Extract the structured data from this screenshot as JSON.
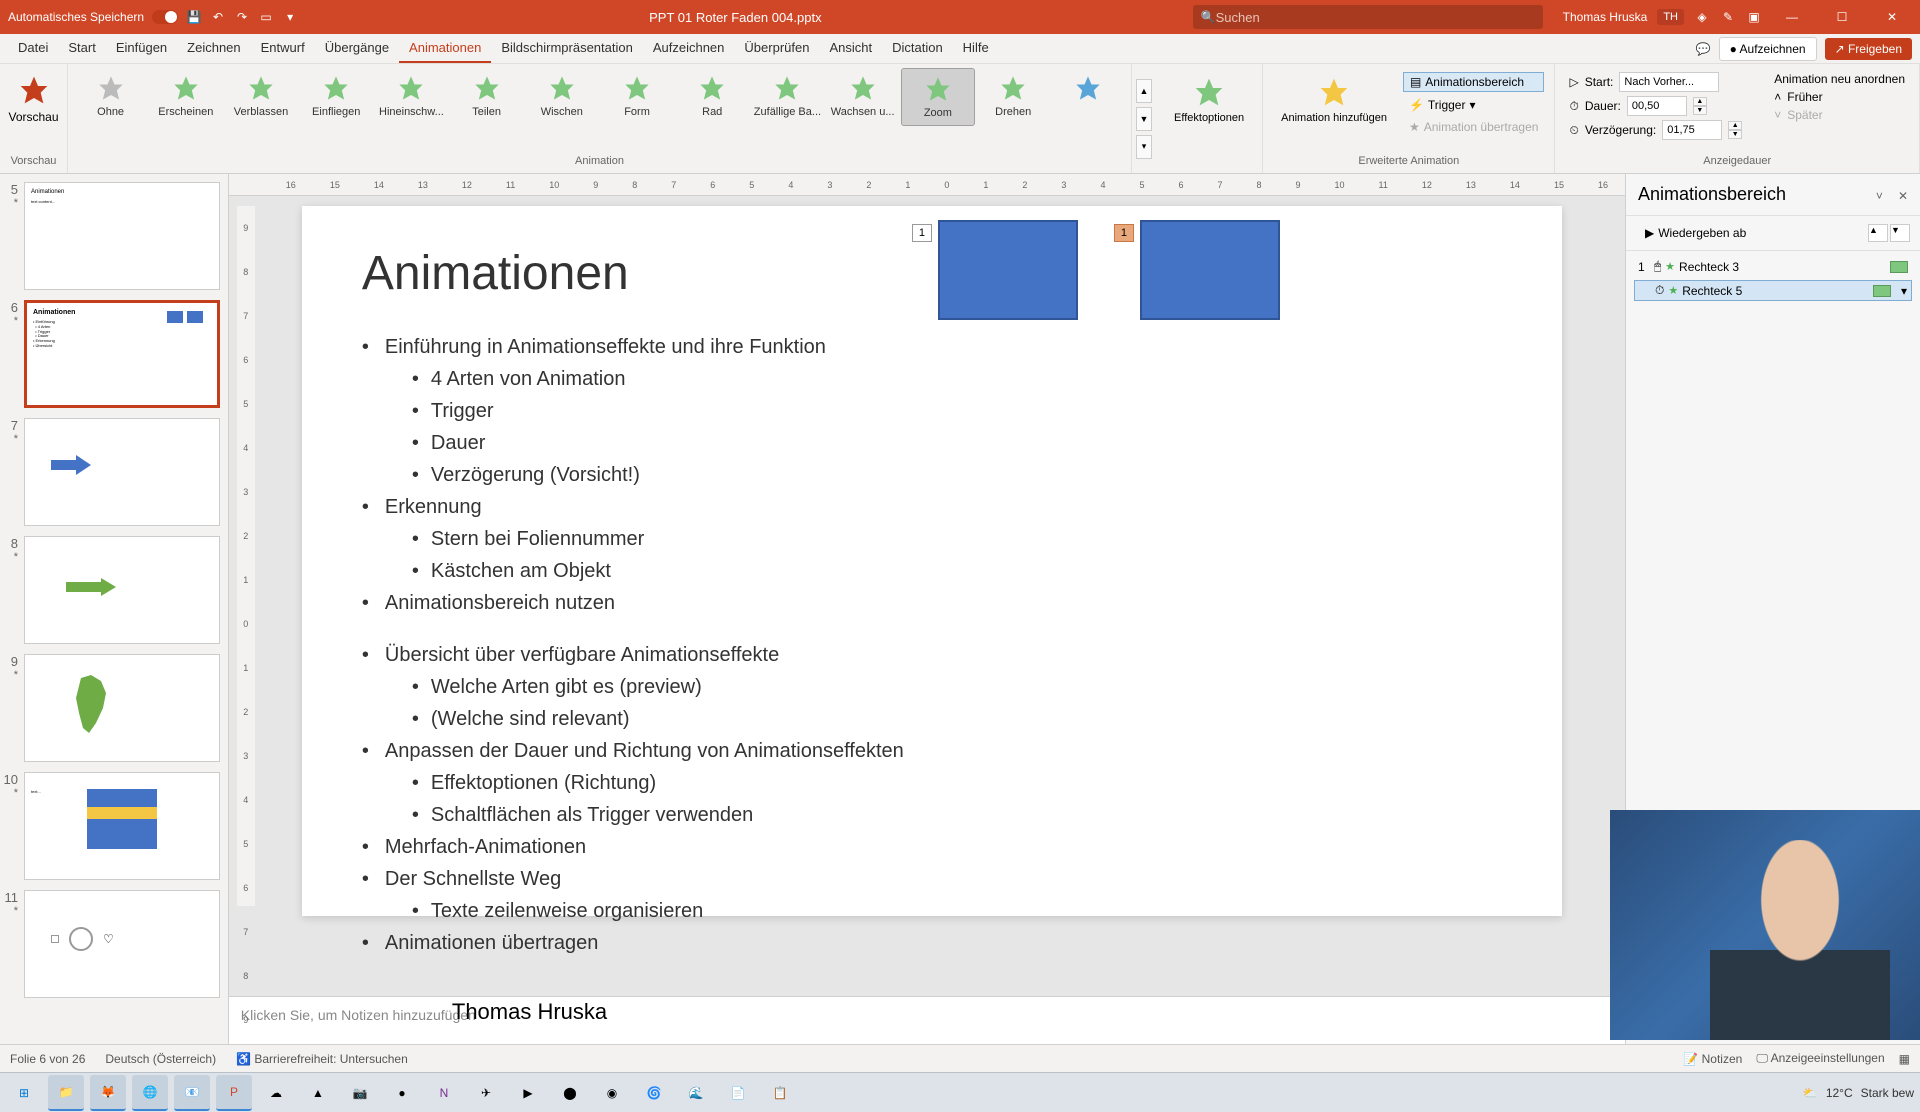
{
  "title_bar": {
    "autosave_label": "Automatisches Speichern",
    "filename": "PPT 01 Roter Faden 004.pptx",
    "search_placeholder": "Suchen",
    "user_name": "Thomas Hruska",
    "user_initials": "TH"
  },
  "menu": {
    "items": [
      "Datei",
      "Start",
      "Einfügen",
      "Zeichnen",
      "Entwurf",
      "Übergänge",
      "Animationen",
      "Bildschirmpräsentation",
      "Aufzeichnen",
      "Überprüfen",
      "Ansicht",
      "Dictation",
      "Hilfe"
    ],
    "active_index": 6,
    "record_btn": "Aufzeichnen",
    "share_btn": "Freigeben"
  },
  "ribbon": {
    "preview_label": "Vorschau",
    "animations": [
      "Ohne",
      "Erscheinen",
      "Verblassen",
      "Einfliegen",
      "Hineinschw...",
      "Teilen",
      "Wischen",
      "Form",
      "Rad",
      "Zufällige Ba...",
      "Wachsen u...",
      "Zoom",
      "Drehen"
    ],
    "selected_anim_index": 11,
    "group_animation": "Animation",
    "effect_options": "Effektoptionen",
    "add_animation": "Animation hinzufügen",
    "anim_pane_btn": "Animationsbereich",
    "trigger_btn": "Trigger",
    "copy_anim": "Animation übertragen",
    "group_extended": "Erweiterte Animation",
    "start_label": "Start:",
    "start_value": "Nach Vorher...",
    "duration_label": "Dauer:",
    "duration_value": "00,50",
    "delay_label": "Verzögerung:",
    "delay_value": "01,75",
    "reorder_label": "Animation neu anordnen",
    "earlier": "Früher",
    "later": "Später",
    "group_timing": "Anzeigedauer"
  },
  "ruler_marks": [
    "16",
    "15",
    "14",
    "13",
    "12",
    "11",
    "10",
    "9",
    "8",
    "7",
    "6",
    "5",
    "4",
    "3",
    "2",
    "1",
    "0",
    "1",
    "2",
    "3",
    "4",
    "5",
    "6",
    "7",
    "8",
    "9",
    "10",
    "11",
    "12",
    "13",
    "14",
    "15",
    "16"
  ],
  "ruler_v_marks": [
    "9",
    "8",
    "7",
    "6",
    "5",
    "4",
    "3",
    "2",
    "1",
    "0",
    "1",
    "2",
    "3",
    "4",
    "5",
    "6",
    "7",
    "8",
    "9"
  ],
  "thumbs": [
    {
      "num": "5",
      "star": "*"
    },
    {
      "num": "6",
      "star": "*",
      "selected": true
    },
    {
      "num": "7",
      "star": "*"
    },
    {
      "num": "8",
      "star": "*"
    },
    {
      "num": "9",
      "star": "*"
    },
    {
      "num": "10",
      "star": "*"
    },
    {
      "num": "11",
      "star": "*"
    }
  ],
  "slide": {
    "title": "Animationen",
    "bullets_1": [
      "Einführung in Animationseffekte und ihre Funktion"
    ],
    "sub_1": [
      "4 Arten von Animation",
      "Trigger",
      "Dauer",
      "Verzögerung (Vorsicht!)"
    ],
    "bullets_2": [
      "Erkennung"
    ],
    "sub_2": [
      "Stern bei Foliennummer",
      "Kästchen am Objekt"
    ],
    "bullets_3": [
      "Animationsbereich nutzen"
    ],
    "bullets_4": [
      "Übersicht über verfügbare Animationseffekte"
    ],
    "sub_4": [
      "Welche Arten gibt es (preview)",
      "(Welche sind relevant)"
    ],
    "bullets_5": [
      "Anpassen der Dauer und Richtung von Animationseffekten"
    ],
    "sub_5": [
      "Effektoptionen (Richtung)",
      "Schaltflächen als Trigger verwenden"
    ],
    "bullets_6": [
      "Mehrfach-Animationen",
      "Der Schnellste Weg"
    ],
    "sub_6": [
      "Texte zeilenweise organisieren"
    ],
    "bullets_7": [
      "Animationen übertragen"
    ],
    "author": "Thomas Hruska",
    "tag1": "1",
    "tag2": "1"
  },
  "anim_pane": {
    "title": "Animationsbereich",
    "play_from": "Wiedergeben ab",
    "items": [
      {
        "seq": "1",
        "name": "Rechteck 3"
      },
      {
        "seq": "",
        "name": "Rechteck 5",
        "selected": true
      }
    ]
  },
  "notes_placeholder": "Klicken Sie, um Notizen hinzuzufügen",
  "status": {
    "slide_info": "Folie 6 von 26",
    "language": "Deutsch (Österreich)",
    "accessibility": "Barrierefreiheit: Untersuchen",
    "notes_btn": "Notizen",
    "display_settings": "Anzeigeeinstellungen"
  },
  "taskbar": {
    "temp": "12°C",
    "weather": "Stark bew"
  }
}
